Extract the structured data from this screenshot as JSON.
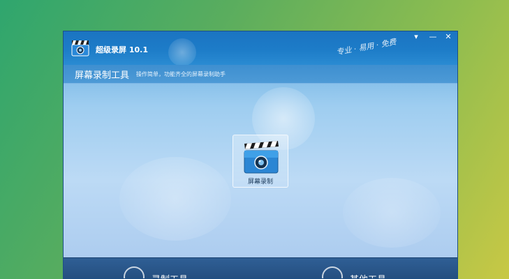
{
  "app": {
    "title": "超级录屏  10.1",
    "slogan": "专业 · 易用 · 免费"
  },
  "header": {
    "title": "屏幕录制工具",
    "description": "操作简单，功能齐全的屏幕录制助手"
  },
  "window_controls": {
    "menu": "▾",
    "minimize": "—",
    "close": "✕"
  },
  "tools": [
    {
      "label": "屏幕录制",
      "icon": "clapperboard-icon"
    }
  ],
  "footer": {
    "items": [
      {
        "label": "录制工具"
      },
      {
        "label": "其他工具"
      }
    ]
  },
  "colors": {
    "titlebar": "#1b74c2",
    "footer": "#244d7e",
    "accent": "#2a6db0"
  }
}
